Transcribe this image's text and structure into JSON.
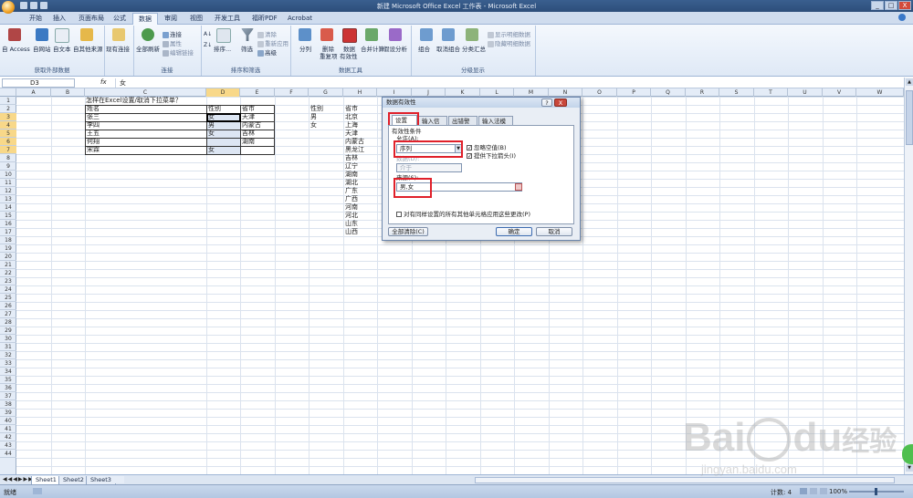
{
  "window": {
    "title": "新建 Microsoft Office Excel 工作表 - Microsoft Excel",
    "min": "_",
    "restore": "□",
    "close": "X"
  },
  "ribbon_tabs": [
    "开始",
    "插入",
    "页面布局",
    "公式",
    "数据",
    "审阅",
    "视图",
    "开发工具",
    "福昕PDF",
    "Acrobat"
  ],
  "active_tab": "数据",
  "ribbon": {
    "external": {
      "label": "获取外部数据",
      "access": "自 Access",
      "web": "自网站",
      "text": "自文本",
      "other": "自其他来源",
      "existing": "现有连接"
    },
    "connections": {
      "label": "连接",
      "refresh": "全部刷新",
      "conn": "连接",
      "props": "属性",
      "edit": "编辑链接"
    },
    "sort": {
      "label": "排序和筛选",
      "sort": "排序...",
      "filter": "筛选",
      "clear": "清除",
      "reapply": "重新应用",
      "advanced": "高级"
    },
    "tools": {
      "label": "数据工具",
      "split": "分列",
      "dedupe_1": "删除",
      "dedupe_2": "重复项",
      "valid_1": "数据",
      "valid_2": "有效性",
      "merge": "合并计算",
      "whatif": "假设分析"
    },
    "outline": {
      "label": "分级显示",
      "group": "组合",
      "ungroup": "取消组合",
      "subtotal": "分类汇总",
      "show": "显示明细数据",
      "hide": "隐藏明细数据"
    }
  },
  "formula_bar": {
    "name_box": "D3",
    "fx": "fx",
    "content": "女"
  },
  "columns": [
    "A",
    "B",
    "C",
    "D",
    "E",
    "F",
    "G",
    "H",
    "I",
    "J",
    "K",
    "L",
    "M",
    "N",
    "O",
    "P",
    "Q",
    "R",
    "S",
    "T",
    "U",
    "V",
    "W"
  ],
  "selected_column": "D",
  "rows": [
    "1",
    "2",
    "3",
    "4",
    "5",
    "6",
    "7",
    "8",
    "9",
    "10",
    "11",
    "12",
    "13",
    "14",
    "15",
    "16",
    "17",
    "18",
    "19",
    "20",
    "21",
    "22",
    "23",
    "24",
    "25",
    "26",
    "27",
    "28",
    "29",
    "30",
    "31",
    "32",
    "33",
    "34",
    "35",
    "36",
    "37",
    "38",
    "39",
    "40",
    "41",
    "42",
    "43",
    "44"
  ],
  "sheet": {
    "title": "怎样在Excel设置/取消下拉菜单？",
    "header": [
      "姓名",
      "性别",
      "省市"
    ],
    "records": [
      [
        "张三",
        "女",
        "天津"
      ],
      [
        "李四",
        "男",
        "内蒙古"
      ],
      [
        "王五",
        "女",
        "吉林"
      ],
      [
        "何翔",
        "",
        "湖南"
      ],
      [
        "宋霖",
        "女",
        ""
      ]
    ],
    "gender_header": "性别",
    "genders": [
      "男",
      "女"
    ],
    "province_header": "省市",
    "provinces": [
      "北京",
      "上海",
      "天津",
      "内蒙古",
      "黑龙江",
      "吉林",
      "辽宁",
      "湖南",
      "湖北",
      "广东",
      "广西",
      "河南",
      "河北",
      "山东",
      "山西"
    ]
  },
  "sheet_tabs": [
    "Sheet1",
    "Sheet2",
    "Sheet3"
  ],
  "status": {
    "ready": "就绪",
    "count": "计数: 4",
    "zoom": "100%"
  },
  "dialog": {
    "title": "数据有效性",
    "help": "?",
    "close": "X",
    "tabs": [
      "设置",
      "输入信息",
      "出错警告",
      "输入法模式"
    ],
    "criteria_label": "有效性条件",
    "allow_label": "允许(A):",
    "allow_value": "序列",
    "ignore_blank": "忽略空值(B)",
    "dropdown": "提供下拉箭头(I)",
    "data_label": "数据(D):",
    "data_value": "介于",
    "source_label": "来源(S):",
    "source_value": "男,女",
    "apply_all": "对有同样设置的所有其他单元格应用这些更改(P)",
    "clear_all": "全部清除(C)",
    "ok": "确定",
    "cancel": "取消"
  },
  "watermark": {
    "brand_a": "Bai",
    "brand_b": "du",
    "brand_c": "经验",
    "url": "jingyan.baidu.com"
  }
}
